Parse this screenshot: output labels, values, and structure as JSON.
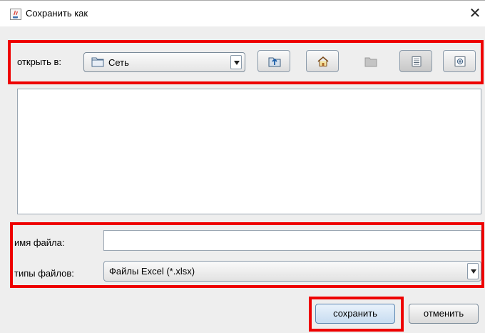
{
  "window": {
    "title": "Сохранить как",
    "close_glyph": "✕",
    "icon": "java-coffee-icon"
  },
  "toolbar": {
    "look_in_label": "открыть в:",
    "look_in_value": "Сеть",
    "look_in_icon": "folder-icon",
    "buttons": [
      {
        "name": "up-one-level",
        "icon": "folder-up-icon",
        "enabled": true
      },
      {
        "name": "home",
        "icon": "home-icon",
        "enabled": true
      },
      {
        "name": "create-new-folder",
        "icon": "new-folder-icon",
        "enabled": false
      },
      {
        "name": "list-view",
        "icon": "list-view-icon",
        "enabled": true,
        "selected": true
      },
      {
        "name": "details-view",
        "icon": "details-view-icon",
        "enabled": true
      }
    ]
  },
  "file_list": {
    "items": []
  },
  "form": {
    "filename_label": "имя файла:",
    "filename_value": "",
    "filetype_label": "типы файлов:",
    "filetype_value": "Файлы Excel (*.xlsx)"
  },
  "actions": {
    "save_label": "сохранить",
    "cancel_label": "отменить"
  },
  "colors": {
    "highlight": "#ee0000",
    "dialog_background": "#eeeeee"
  }
}
